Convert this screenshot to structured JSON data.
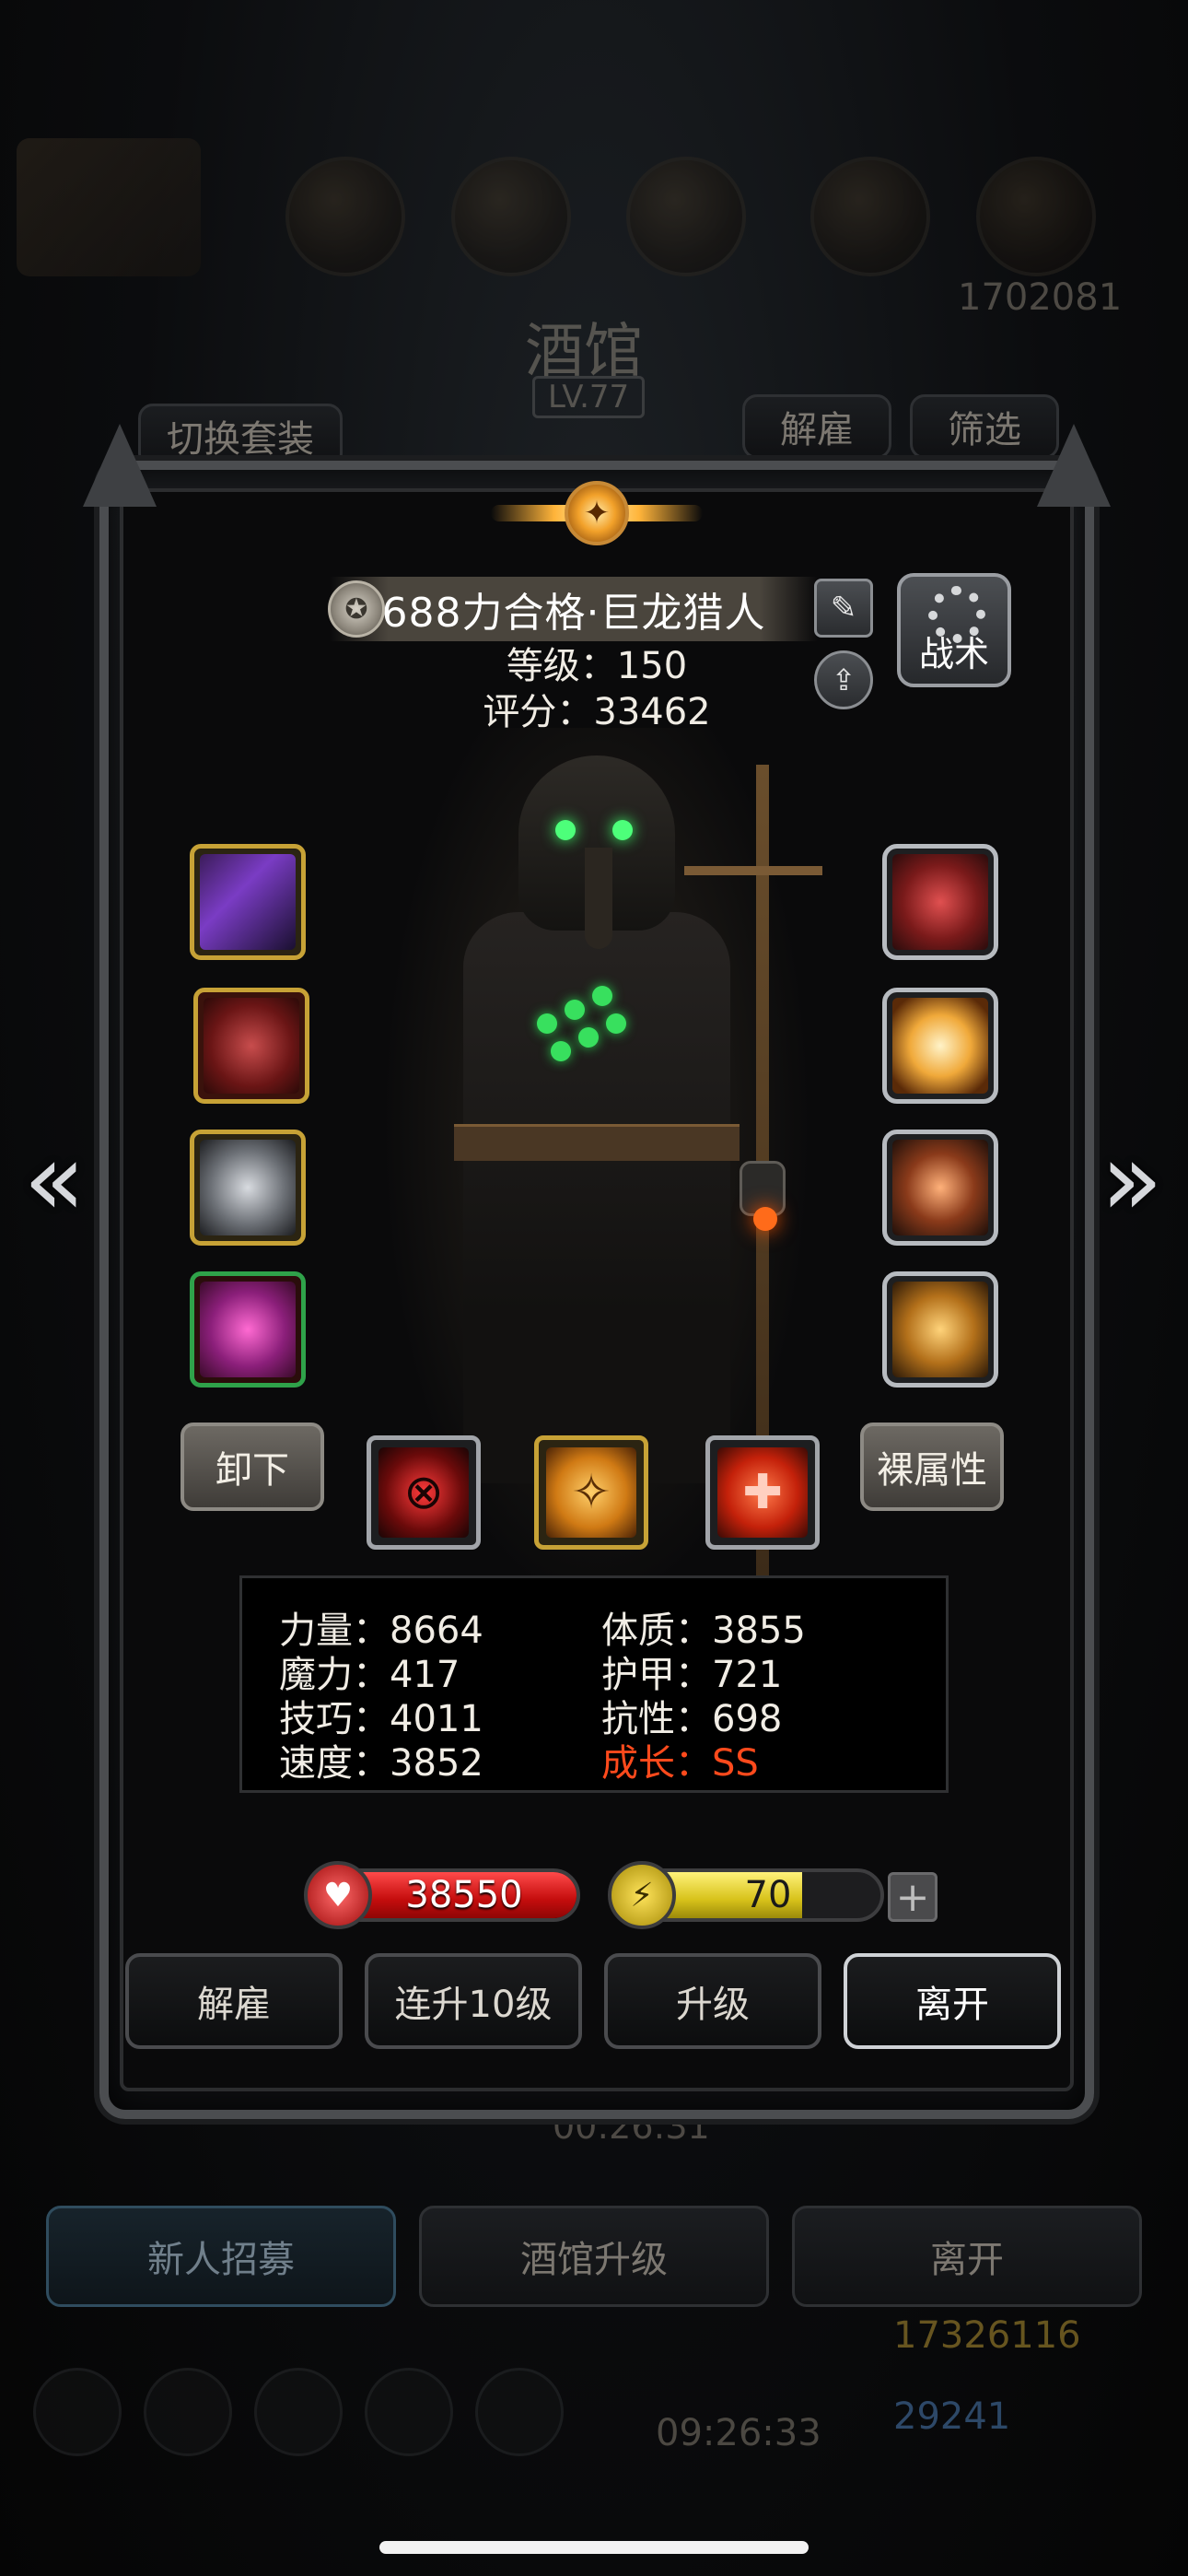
{
  "background": {
    "title": "酒馆",
    "level": "LV.77",
    "switch_set": "切换套装",
    "dismiss": "解雇",
    "filter": "筛选",
    "gold_top": "1702081",
    "timer": "00:26:31",
    "recruit": "新人招募",
    "tavern_upgrade": "酒馆升级",
    "leave": "离开",
    "gold": "17326116",
    "gems": "29241",
    "clock": "09:26:33"
  },
  "hero": {
    "name": "688力合格·巨龙猎人",
    "level_label": "等级：150",
    "score_label": "评分：33462",
    "tactics_label": "战术"
  },
  "buttons": {
    "unequip": "卸下",
    "naked_stats": "裸属性",
    "dismiss": "解雇",
    "level_up_10": "连升10级",
    "level_up": "升级",
    "leave": "离开",
    "plus": "+"
  },
  "stats": {
    "strength": "力量：8664",
    "constitution": "体质：3855",
    "magic": "魔力：417",
    "armor": "护甲：721",
    "skill": "技巧：4011",
    "resistance": "抗性：698",
    "speed": "速度：3852",
    "growth": "成长：SS"
  },
  "bars": {
    "hp": "38550",
    "hp_fraction": 1.0,
    "energy": "70",
    "energy_fraction": 0.7
  },
  "icons": {
    "medal": "medal-icon",
    "edit": "edit-icon",
    "upload": "upload-icon",
    "gear": "gear-icon",
    "heart": "heart-icon",
    "lightning": "lightning-icon",
    "left_arrow": "double-chevron-left-icon",
    "right_arrow": "double-chevron-right-icon"
  },
  "colors": {
    "growth_text": "#ff4a1c",
    "hp_fill": "#c40d0d",
    "energy_fill": "#d7c21a",
    "emblem_gold": "#ffb43a"
  }
}
